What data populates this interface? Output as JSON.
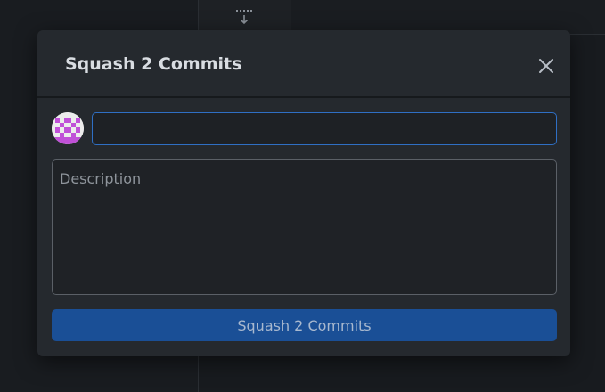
{
  "app": {
    "toolbar_icon": "dotted-arrow-down-icon"
  },
  "modal": {
    "title": "Squash 2 Commits",
    "close_icon": "close-icon",
    "avatar_icon": "identicon-avatar",
    "summary": {
      "value": "",
      "placeholder": ""
    },
    "description": {
      "value": "",
      "placeholder": "Description"
    },
    "submit_label": "Squash 2 Commits"
  },
  "colors": {
    "accent": "#2f6fc4",
    "button": "#1a4f96",
    "modal_bg": "#25292e",
    "avatar_pattern": "#c050d8"
  }
}
